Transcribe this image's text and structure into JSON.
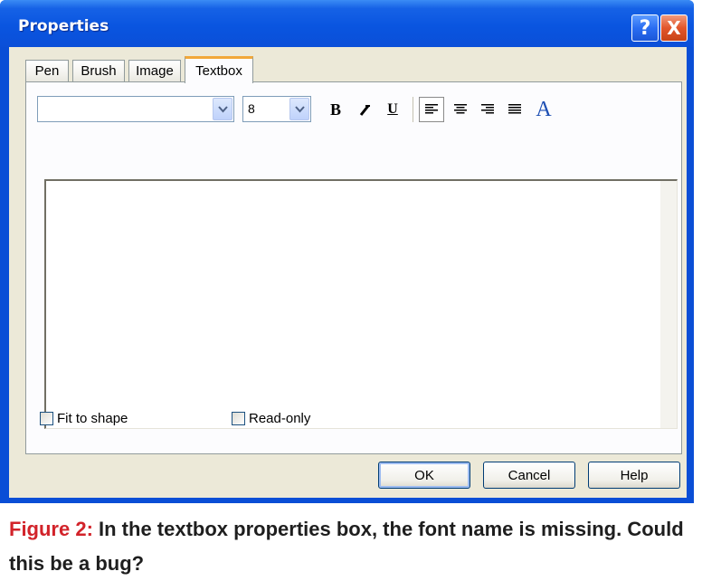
{
  "window": {
    "title": "Properties",
    "help_symbol": "?",
    "close_symbol": "X"
  },
  "tabs": [
    {
      "label": "Pen",
      "active": false
    },
    {
      "label": "Brush",
      "active": false
    },
    {
      "label": "Image",
      "active": false
    },
    {
      "label": "Textbox",
      "active": true
    }
  ],
  "toolbar": {
    "font_name": "",
    "font_size": "8",
    "bold_label": "B",
    "underline_label": "U",
    "font_color_label": "A",
    "icons": [
      "chevron-down-icon",
      "italic-icon",
      "align-left-icon",
      "align-center-icon",
      "align-right-icon",
      "align-justify-icon"
    ]
  },
  "text_content": "",
  "checkboxes": {
    "fit_to_shape": {
      "label": "Fit to shape",
      "checked": false
    },
    "read_only": {
      "label": "Read-only",
      "checked": false
    }
  },
  "buttons": {
    "ok": "OK",
    "cancel": "Cancel",
    "help": "Help"
  },
  "caption": {
    "figure_label": "Figure 2:",
    "text": " In the textbox properties box, the font name is missing. Could this be a bug?"
  },
  "colors": {
    "titlebar": "#0a55e0",
    "dialog_face": "#ece9d8",
    "active_tab_accent": "#f1a83a",
    "figure_label": "#d2232a"
  }
}
